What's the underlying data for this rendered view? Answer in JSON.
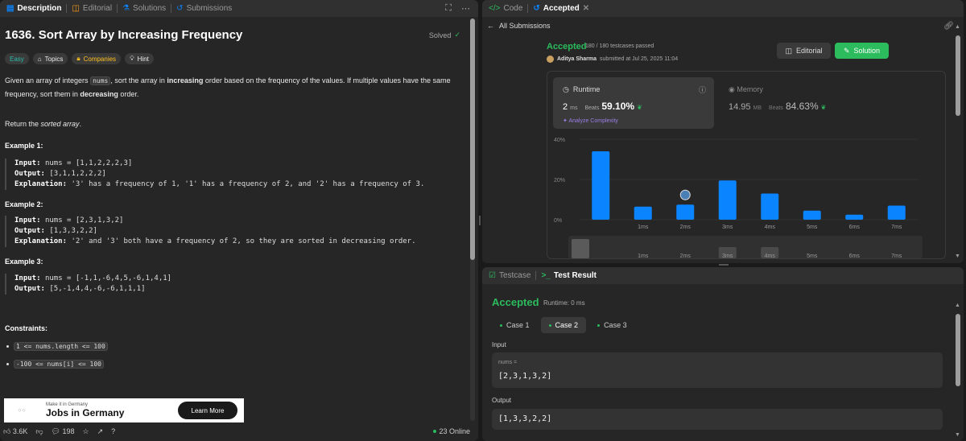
{
  "left": {
    "tabs": [
      {
        "label": "Description",
        "icon": "description-icon"
      },
      {
        "label": "Editorial",
        "icon": "book-icon"
      },
      {
        "label": "Solutions",
        "icon": "flask-icon"
      },
      {
        "label": "Submissions",
        "icon": "history-icon"
      }
    ],
    "problem_title": "1636. Sort Array by Increasing Frequency",
    "solved_label": "Solved",
    "chips": [
      "Easy",
      "Topics",
      "Companies",
      "Hint"
    ],
    "desc_1": "Given an array of integers ",
    "desc_code": "nums",
    "desc_2": ", sort the array in ",
    "desc_bold_1": "increasing",
    "desc_3": " order based on the frequency of the values. If multiple values have the same frequency, sort them in ",
    "desc_bold_2": "decreasing",
    "desc_4": " order.",
    "return_1": "Return the ",
    "return_em": "sorted array",
    "return_2": ".",
    "examples": [
      {
        "title": "Example 1:",
        "input": "nums = [1,1,2,2,2,3]",
        "output": "[3,1,1,2,2,2]",
        "explanation": "'3' has a frequency of 1, '1' has a frequency of 2, and '2' has a frequency of 3."
      },
      {
        "title": "Example 2:",
        "input": "nums = [2,3,1,3,2]",
        "output": "[1,3,3,2,2]",
        "explanation": "'2' and '3' both have a frequency of 2, so they are sorted in decreasing order."
      },
      {
        "title": "Example 3:",
        "input": "nums = [-1,1,-6,4,5,-6,1,4,1]",
        "output": "[5,-1,4,4,-6,-6,1,1,1]"
      }
    ],
    "labels": {
      "input": "Input:",
      "output": "Output:",
      "explanation": "Explanation:"
    },
    "constraints_title": "Constraints:",
    "constraints": [
      "1 <= nums.length <= 100",
      "-100 <= nums[i] <= 100"
    ],
    "ad": {
      "small": "Make it in Germany",
      "big": "Jobs in Germany",
      "button": "Learn More"
    },
    "footer": {
      "likes": "3.6K",
      "comments": "198",
      "online": "23 Online"
    }
  },
  "right_top": {
    "tabs": [
      {
        "label": "Code"
      },
      {
        "label": "Accepted"
      }
    ],
    "back_label": "All Submissions",
    "status": "Accepted",
    "testcases": "180 / 180 testcases passed",
    "user": "Aditya Sharma",
    "submitted": "submitted at Jul 25, 2025 11:04",
    "editorial_btn": "Editorial",
    "solution_btn": "Solution",
    "runtime": {
      "label": "Runtime",
      "value": "2",
      "unit": "ms",
      "beats_label": "Beats",
      "beats": "59.10%",
      "analyze": "Analyze Complexity"
    },
    "memory": {
      "label": "Memory",
      "value": "14.95",
      "unit": "MB",
      "beats_label": "Beats",
      "beats": "84.63%"
    }
  },
  "chart_data": {
    "type": "bar",
    "categories": [
      "",
      "1ms",
      "2ms",
      "3ms",
      "4ms",
      "5ms",
      "6ms",
      "7ms"
    ],
    "values": [
      34,
      6.5,
      7.5,
      19.5,
      13,
      4.5,
      2.5,
      7
    ],
    "highlight_index": 2,
    "y_ticks": [
      "0%",
      "20%",
      "40%"
    ],
    "ylim": [
      0,
      40
    ],
    "bar_color": "#0a84ff",
    "minimap_labels": [
      "1ms",
      "2ms",
      "3ms",
      "4ms",
      "5ms",
      "6ms",
      "7ms"
    ]
  },
  "right_bottom": {
    "tabs": [
      {
        "label": "Testcase"
      },
      {
        "label": "Test Result"
      }
    ],
    "status": "Accepted",
    "runtime": "Runtime: 0 ms",
    "cases": [
      "Case 1",
      "Case 2",
      "Case 3"
    ],
    "input_label": "Input",
    "var_name": "nums =",
    "input_value": "[2,3,1,3,2]",
    "output_label": "Output",
    "output_value": "[1,3,3,2,2]"
  },
  "colors": {
    "accent_green": "#2cbb5d",
    "bar_blue": "#0a84ff",
    "panel": "#262626",
    "background": "#1a1a1a"
  }
}
